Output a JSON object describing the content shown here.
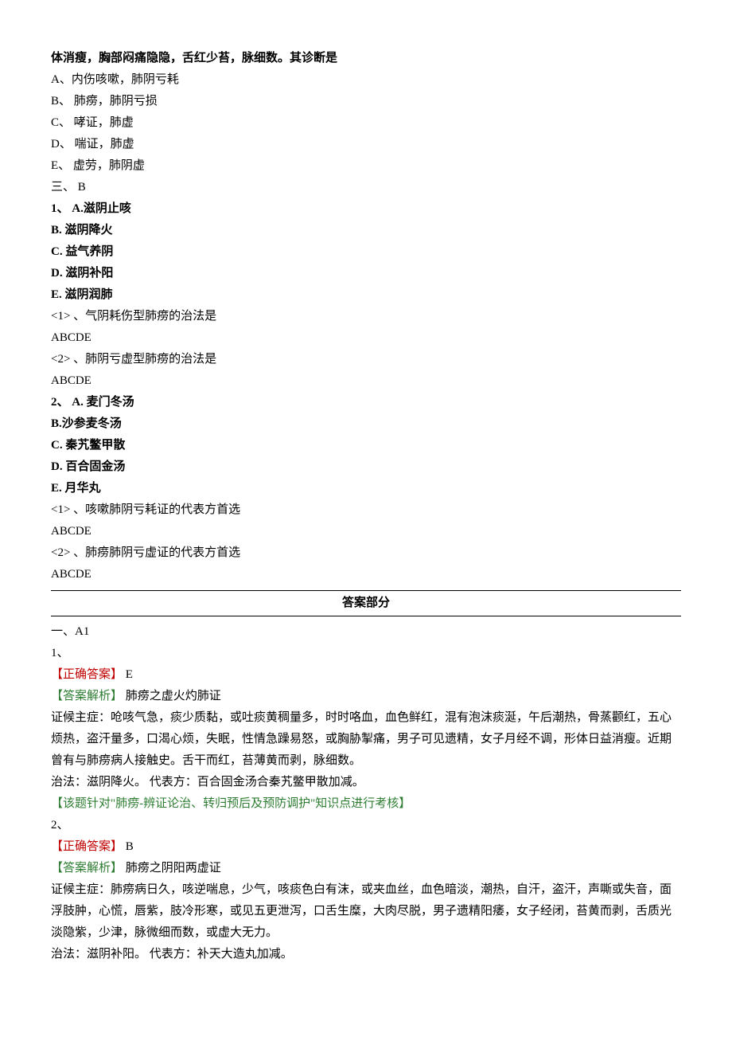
{
  "stem": "体消瘦，胸部闷痛隐隐，舌红少苔，脉细数。其诊断是",
  "options": {
    "A": "A、内伤咳嗽，肺阴亏耗",
    "B": "B、 肺痨，肺阴亏损",
    "C": "C、 哮证，肺虚",
    "D": "D、 喘证，肺虚",
    "E": "E、 虚劳，肺阴虚"
  },
  "section3": "三、 B",
  "q1": {
    "header": "1、 A.滋阴止咳",
    "B": "B. 滋阴降火",
    "C": "C. 益气养阴",
    "D": "D. 滋阴补阳",
    "E": "E. 滋阴润肺",
    "sub1": "<1> 、气阴耗伤型肺痨的治法是",
    "abcde1": "ABCDE",
    "sub2": "<2> 、肺阴亏虚型肺痨的治法是",
    "abcde2": "ABCDE"
  },
  "q2": {
    "header": "2、 A. 麦门冬汤",
    "B": "B.沙参麦冬汤",
    "C": "C. 秦艽鳖甲散",
    "D": "D. 百合固金汤",
    "E": "E. 月华丸",
    "sub1": "<1> 、咳嗽肺阴亏耗证的代表方首选",
    "abcde1": "ABCDE",
    "sub2": "<2> 、肺痨肺阴亏虚证的代表方首选",
    "abcde2": "ABCDE"
  },
  "answerHeader": "答案部分",
  "ans": {
    "sectionA1": "一、A1",
    "a1": {
      "num": "1、",
      "correctLabel": "【正确答案】",
      "correctVal": " E",
      "analysisLabel": "【答案解析】",
      "analysisTitle": " 肺痨之虚火灼肺证",
      "line1": "证候主症：呛咳气急，痰少质黏，或吐痰黄稠量多，时时咯血，血色鲜红，混有泡沫痰涎，午后潮热，骨蒸颧红，五心烦热，盗汗量多，口渴心烦，失眠，性情急躁易怒，或胸胁掣痛，男子可见遗精，女子月经不调，形体日益消瘦。近期曾有与肺痨病人接触史。舌干而红，苔薄黄而剥，脉细数。",
      "line2": "治法：滋阴降火。 代表方：百合固金汤合秦艽鳖甲散加减。",
      "note1": "【该题针对\"",
      "noteGreen": "肺痨-辨证论治、转归预后及预防调护",
      "note2": "\"知识点进行考核】"
    },
    "a2": {
      "num": "2、",
      "correctLabel": "【正确答案】",
      "correctVal": " B",
      "analysisLabel": "【答案解析】",
      "analysisTitle": " 肺痨之阴阳两虚证",
      "line1": "证候主症：肺痨病日久，咳逆喘息，少气，咳痰色白有沫，或夹血丝，血色暗淡，潮热，自汗，盗汗，声嘶或失音，面浮肢肿，心慌，唇紫，肢冷形寒，或见五更泄泻，口舌生糜，大肉尽脱，男子遗精阳痿，女子经闭，苔黄而剥，舌质光淡隐紫，少津，脉微细而数，或虚大无力。",
      "line2": "治法：滋阴补阳。 代表方：补天大造丸加减。"
    }
  }
}
